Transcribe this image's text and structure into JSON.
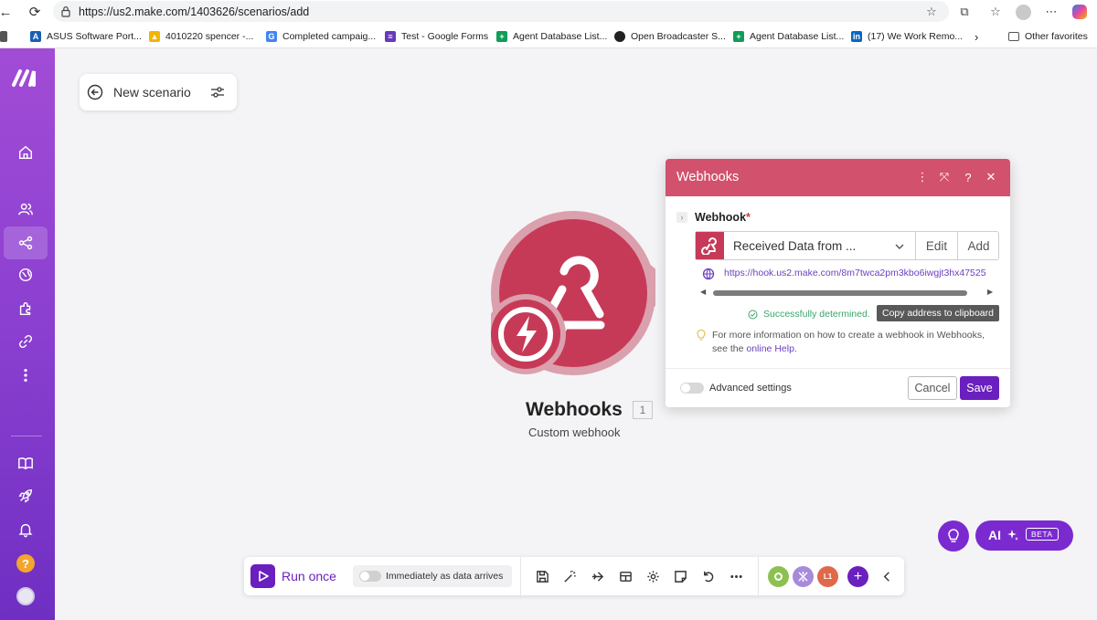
{
  "browser": {
    "url": "https://us2.make.com/1403626/scenarios/add",
    "bookmarks": [
      {
        "label": "ASUS Software Port...",
        "color": "#1a5fb4"
      },
      {
        "label": "4010220 spencer -...",
        "color": "#f4b400"
      },
      {
        "label": "Completed campaig...",
        "color": "#4285f4"
      },
      {
        "label": "Test - Google Forms",
        "color": "#673ab7"
      },
      {
        "label": "Agent Database List...",
        "color": "#0f9d58"
      },
      {
        "label": "Open Broadcaster S...",
        "color": "#222222"
      },
      {
        "label": "Agent Database List...",
        "color": "#0f9d58"
      },
      {
        "label": "(17) We Work Remo...",
        "color": "#0a66c2"
      }
    ],
    "other_favorites": "Other favorites"
  },
  "scenario": {
    "title": "New scenario"
  },
  "module": {
    "name": "Webhooks",
    "number": "1",
    "subtitle": "Custom webhook",
    "color": "#c63a58"
  },
  "dialog": {
    "title": "Webhooks",
    "field_label": "Webhook",
    "required_mark": "*",
    "selected_value": "Received Data from ...",
    "edit_label": "Edit",
    "add_label": "Add",
    "url": "https://hook.us2.make.com/8m7twca2pm3kbo6iwgjt3hx47525",
    "success": "Successfully determined.",
    "tooltip": "Copy address to clipboard",
    "info_text": "For more information on how to create a webhook in Webhooks, see the",
    "info_link": "online Help",
    "info_end": ".",
    "advanced_label": "Advanced settings",
    "cancel_label": "Cancel",
    "save_label": "Save"
  },
  "toolbar": {
    "run_label": "Run once",
    "schedule_label": "Immediately as data arrives",
    "user_badge": "L1"
  },
  "ai": {
    "label": "AI",
    "beta": "BETA"
  },
  "colors": {
    "accent": "#6a1fbf",
    "header": "#d2516d",
    "sidebar_top": "#a24cd6",
    "sidebar_bottom": "#6f2fc2"
  }
}
